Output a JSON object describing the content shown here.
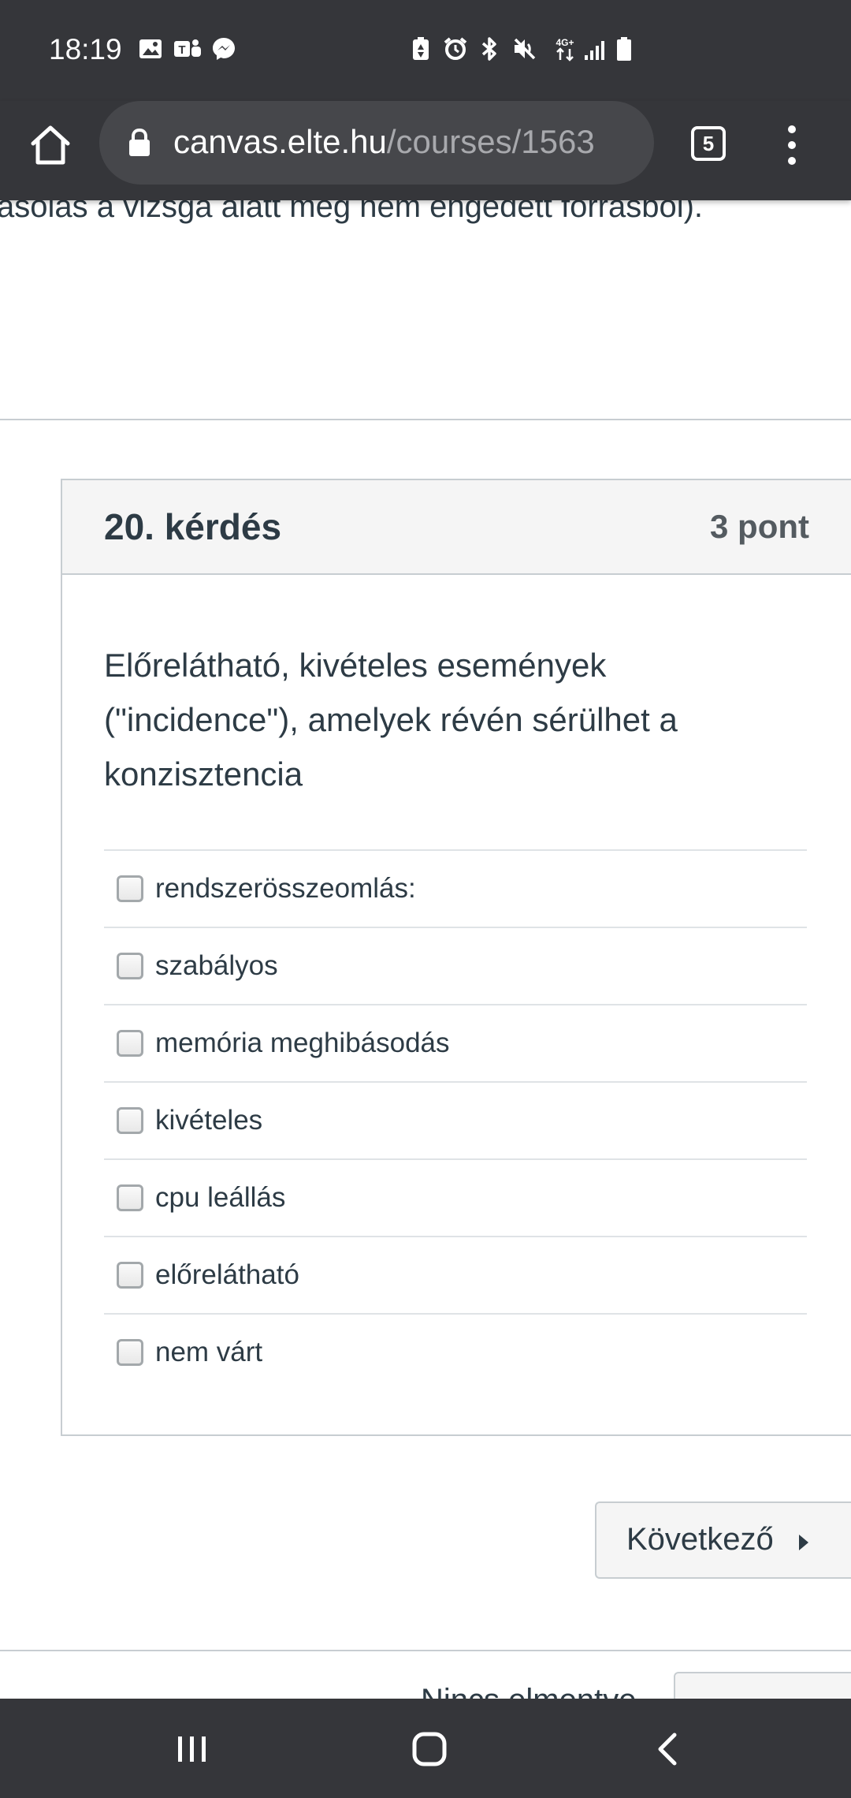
{
  "status_bar": {
    "time": "18:19",
    "network": "4G+",
    "icons": [
      "gallery-icon",
      "teams-icon",
      "messenger-icon",
      "battery-saver-icon",
      "alarm-icon",
      "bluetooth-icon",
      "mute-icon",
      "network-4g-icon",
      "signal-icon",
      "battery-icon"
    ]
  },
  "browser": {
    "url_host": "canvas.elte.hu",
    "url_path": "/courses/1563",
    "tab_count": "5"
  },
  "page": {
    "cut_text": "ásolás a vizsga alatt meg nem engedett forrásból)."
  },
  "question": {
    "title": "20. kérdés",
    "points": "3 pont",
    "text": "Előrelátható, kivételes események (\"incidence\"), amelyek révén sérülhet a konzisztencia",
    "answers": [
      "rendszerösszeomlás:",
      "szabályos",
      "memória meghibásodás",
      "kivételes",
      "cpu leállás",
      "előrelátható",
      "nem várt"
    ]
  },
  "navigation": {
    "next_label": "Következő",
    "partial_text": "Nincs elmentve"
  },
  "colors": {
    "bars": "#35363a",
    "text": "#2d3b45",
    "border": "#c7cdd1",
    "header_bg": "#f5f5f5"
  }
}
